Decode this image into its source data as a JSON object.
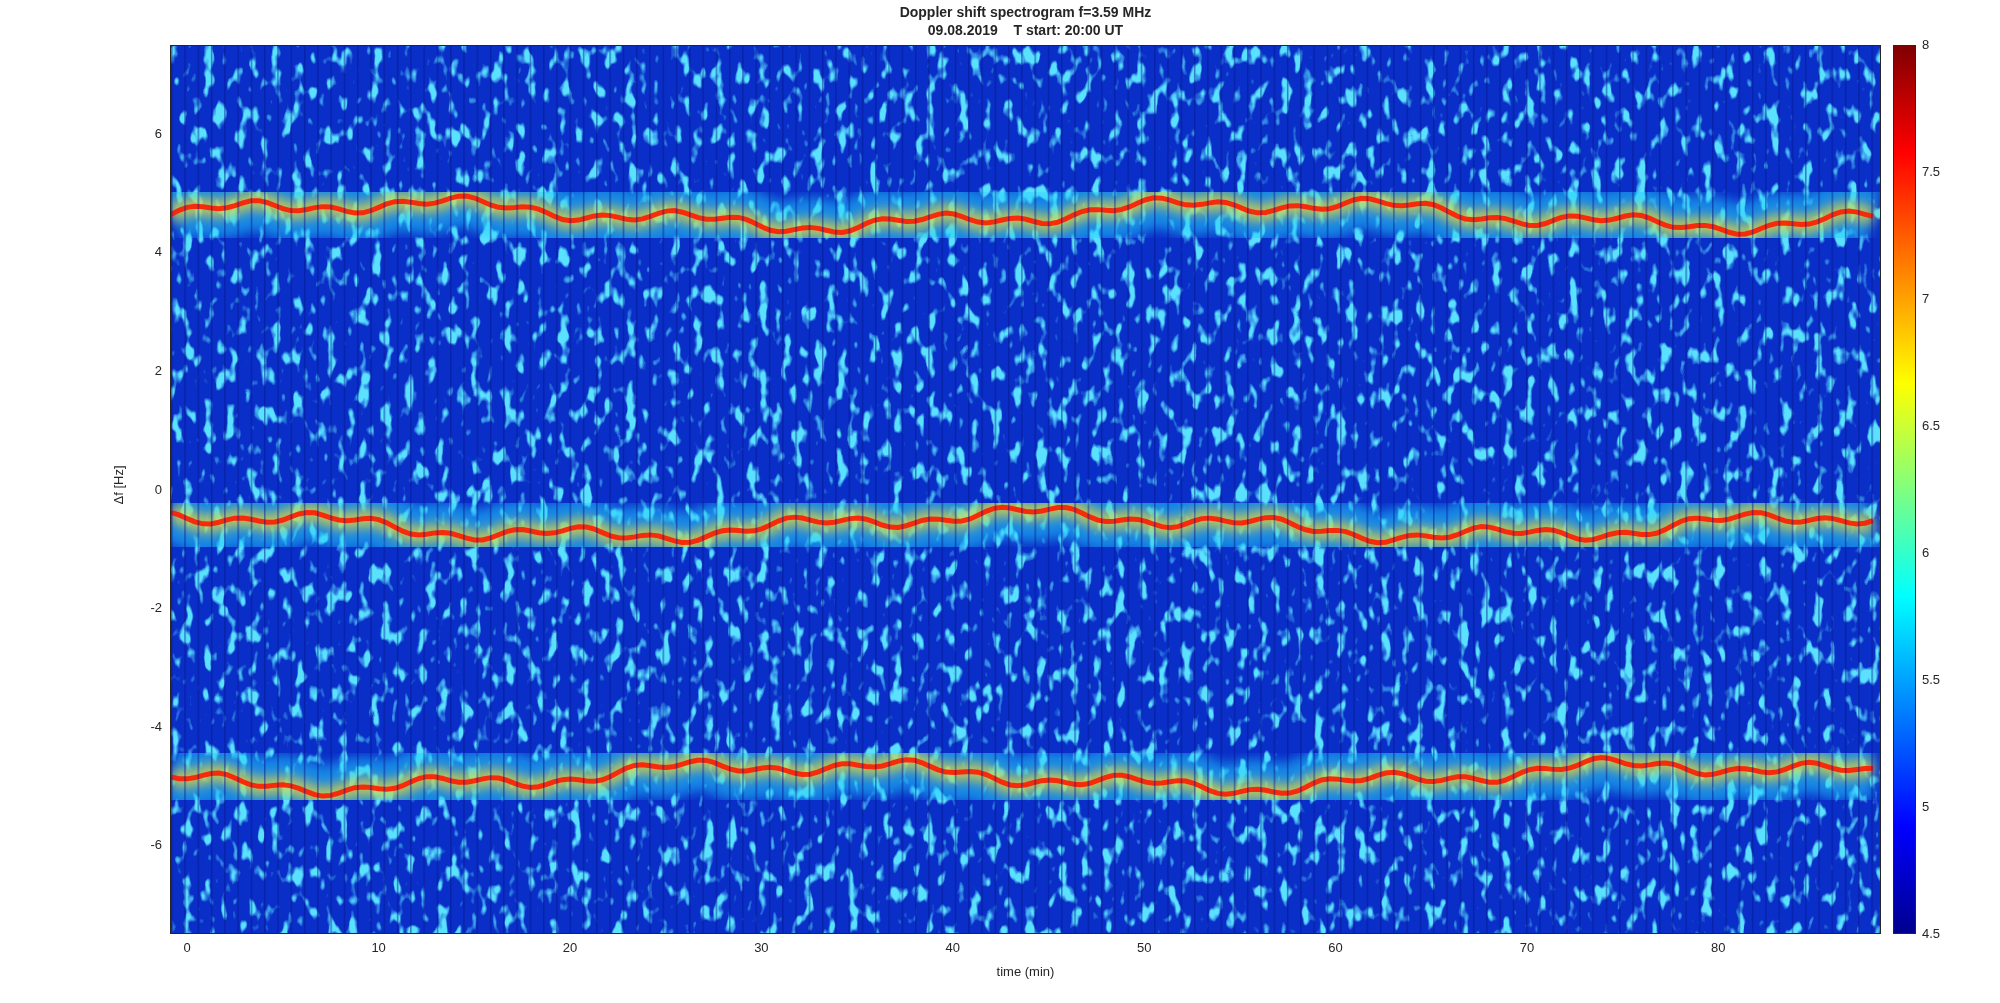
{
  "figure": {
    "title": [
      "Doppler shift spectrogram f=3.59 MHz",
      "09.08.2019    T start: 20:00 UT"
    ],
    "xlabel": "time (min)",
    "ylabel": "Δf [Hz]",
    "xticks": [
      "0",
      "10",
      "20",
      "30",
      "40",
      "50",
      "60",
      "70",
      "80"
    ],
    "yticks": [
      "6",
      "4",
      "2",
      "0",
      "-2",
      "-4",
      "-6"
    ],
    "colorbar": {
      "ticks": [
        "8",
        "7.5",
        "7",
        "6.5",
        "6",
        "5.5",
        "5",
        "4.5"
      ]
    }
  }
}
